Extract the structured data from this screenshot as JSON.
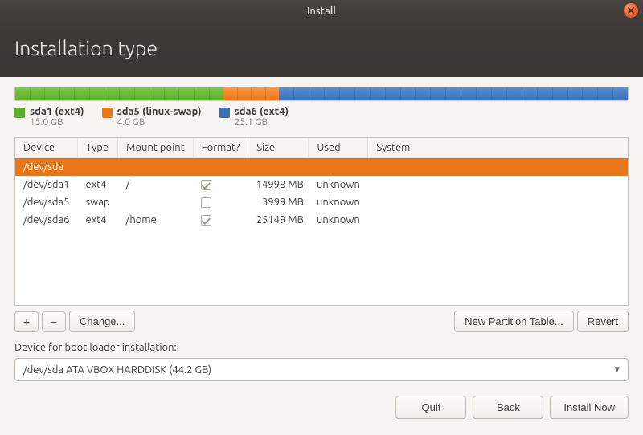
{
  "titlebar": {
    "title": "Install"
  },
  "header": {
    "title": "Installation type"
  },
  "chart_data": {
    "type": "bar",
    "title": "",
    "xlabel": "",
    "ylabel": "",
    "categories": [
      "sda1 (ext4)",
      "sda5 (linux-swap)",
      "sda6 (ext4)"
    ],
    "values": [
      15.0,
      4.0,
      25.1
    ],
    "unit": "GB",
    "total": 44.2
  },
  "legend": [
    {
      "name": "sda1 (ext4)",
      "size": "15.0 GB",
      "color": "#5aab2a"
    },
    {
      "name": "sda5 (linux-swap)",
      "size": "4.0 GB",
      "color": "#e8751a"
    },
    {
      "name": "sda6 (ext4)",
      "size": "25.1 GB",
      "color": "#3b6fb5"
    }
  ],
  "table": {
    "headers": {
      "device": "Device",
      "type": "Type",
      "mount": "Mount point",
      "format": "Format?",
      "size": "Size",
      "used": "Used",
      "system": "System"
    },
    "rows": [
      {
        "device": "/dev/sda",
        "type": "",
        "mount": "",
        "format": null,
        "size": "",
        "used": "",
        "system": "",
        "selected": true
      },
      {
        "device": "/dev/sda1",
        "type": "ext4",
        "mount": "/",
        "format": true,
        "size": "14998 MB",
        "used": "unknown",
        "system": ""
      },
      {
        "device": "/dev/sda5",
        "type": "swap",
        "mount": "",
        "format": false,
        "size": "3999 MB",
        "used": "unknown",
        "system": ""
      },
      {
        "device": "/dev/sda6",
        "type": "ext4",
        "mount": "/home",
        "format": true,
        "size": "25149 MB",
        "used": "unknown",
        "system": ""
      }
    ]
  },
  "toolbar": {
    "add": "+",
    "remove": "−",
    "change": "Change...",
    "new_table": "New Partition Table...",
    "revert": "Revert"
  },
  "boot": {
    "label": "Device for boot loader installation:",
    "selected": "/dev/sda   ATA VBOX HARDDISK (44.2 GB)"
  },
  "footer": {
    "quit": "Quit",
    "back": "Back",
    "install": "Install Now"
  }
}
